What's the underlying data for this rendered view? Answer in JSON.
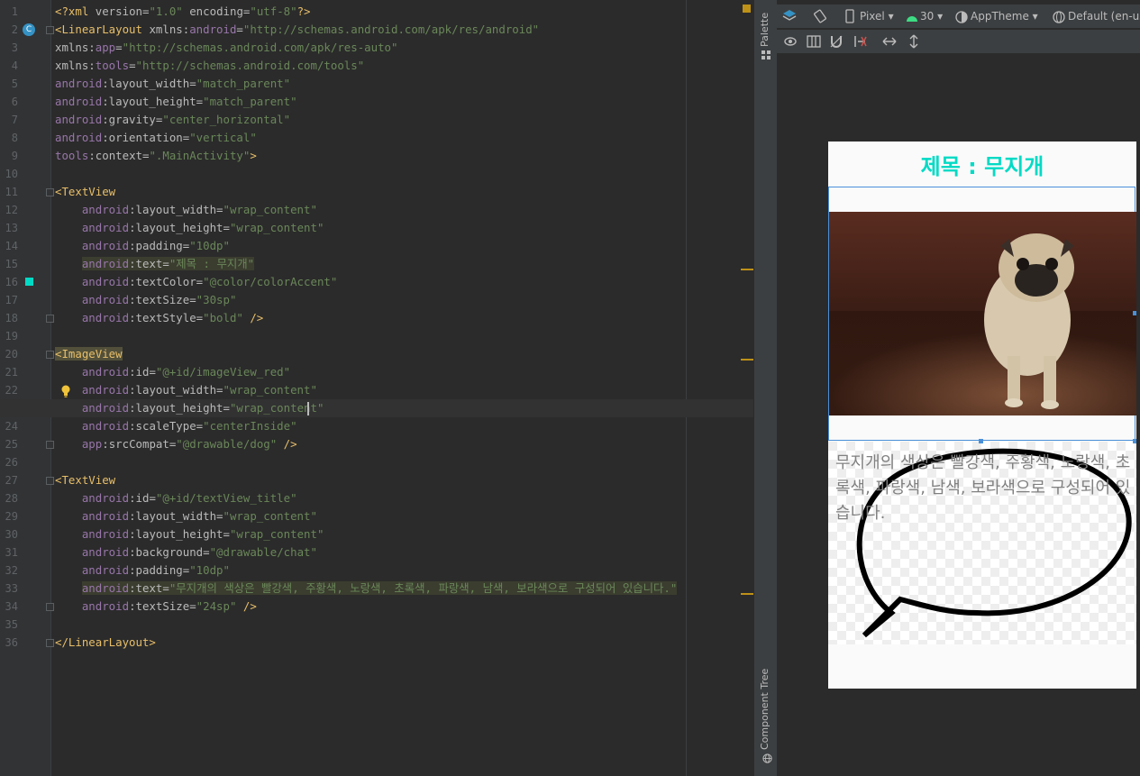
{
  "editor": {
    "lines": [
      {
        "n": "1",
        "tokens": [
          [
            "tag",
            "<?xml "
          ],
          [
            "attr",
            "version="
          ],
          [
            "str",
            "\"1.0\""
          ],
          [
            "attr",
            " encoding="
          ],
          [
            "str",
            "\"utf-8\""
          ],
          [
            "tag",
            "?>"
          ]
        ]
      },
      {
        "n": "2",
        "tokens": [
          [
            "tag",
            "<LinearLayout "
          ],
          [
            "attr",
            "xmlns:"
          ],
          [
            "ns",
            "android"
          ],
          [
            "attr",
            "="
          ],
          [
            "str",
            "\"http://schemas.android.com/apk/res/android\""
          ]
        ]
      },
      {
        "n": "3",
        "tokens": [
          [
            "attr",
            "xmlns:"
          ],
          [
            "ns",
            "app"
          ],
          [
            "attr",
            "="
          ],
          [
            "str",
            "\"http://schemas.android.com/apk/res-auto\""
          ]
        ]
      },
      {
        "n": "4",
        "tokens": [
          [
            "attr",
            "xmlns:"
          ],
          [
            "ns",
            "tools"
          ],
          [
            "attr",
            "="
          ],
          [
            "str",
            "\"http://schemas.android.com/tools\""
          ]
        ]
      },
      {
        "n": "5",
        "tokens": [
          [
            "ns",
            "android"
          ],
          [
            "attr",
            ":layout_width="
          ],
          [
            "str",
            "\"match_parent\""
          ]
        ]
      },
      {
        "n": "6",
        "tokens": [
          [
            "ns",
            "android"
          ],
          [
            "attr",
            ":layout_height="
          ],
          [
            "str",
            "\"match_parent\""
          ]
        ]
      },
      {
        "n": "7",
        "tokens": [
          [
            "ns",
            "android"
          ],
          [
            "attr",
            ":gravity="
          ],
          [
            "str",
            "\"center_horizontal\""
          ]
        ]
      },
      {
        "n": "8",
        "tokens": [
          [
            "ns",
            "android"
          ],
          [
            "attr",
            ":orientation="
          ],
          [
            "str",
            "\"vertical\""
          ]
        ]
      },
      {
        "n": "9",
        "tokens": [
          [
            "ns",
            "tools"
          ],
          [
            "attr",
            ":context="
          ],
          [
            "str",
            "\".MainActivity\""
          ],
          [
            "tag",
            ">"
          ]
        ]
      },
      {
        "n": "10",
        "tokens": []
      },
      {
        "n": "11",
        "tokens": [
          [
            "tag",
            "<TextView"
          ]
        ]
      },
      {
        "n": "12",
        "tokens": [
          [
            "attr",
            "    "
          ],
          [
            "ns",
            "android"
          ],
          [
            "attr",
            ":layout_width="
          ],
          [
            "str",
            "\"wrap_content\""
          ]
        ]
      },
      {
        "n": "13",
        "tokens": [
          [
            "attr",
            "    "
          ],
          [
            "ns",
            "android"
          ],
          [
            "attr",
            ":layout_height="
          ],
          [
            "str",
            "\"wrap_content\""
          ]
        ]
      },
      {
        "n": "14",
        "tokens": [
          [
            "attr",
            "    "
          ],
          [
            "ns",
            "android"
          ],
          [
            "attr",
            ":padding="
          ],
          [
            "str",
            "\"10dp\""
          ]
        ]
      },
      {
        "n": "15",
        "hl": true,
        "tokens": [
          [
            "attr",
            "    "
          ],
          [
            "ns",
            "android"
          ],
          [
            "attr",
            ":text="
          ],
          [
            "str",
            "\"제목 : 무지개\""
          ]
        ]
      },
      {
        "n": "16",
        "tokens": [
          [
            "attr",
            "    "
          ],
          [
            "ns",
            "android"
          ],
          [
            "attr",
            ":textColor="
          ],
          [
            "str",
            "\"@color/colorAccent\""
          ]
        ]
      },
      {
        "n": "17",
        "tokens": [
          [
            "attr",
            "    "
          ],
          [
            "ns",
            "android"
          ],
          [
            "attr",
            ":textSize="
          ],
          [
            "str",
            "\"30sp\""
          ]
        ]
      },
      {
        "n": "18",
        "tokens": [
          [
            "attr",
            "    "
          ],
          [
            "ns",
            "android"
          ],
          [
            "attr",
            ":textStyle="
          ],
          [
            "str",
            "\"bold\""
          ],
          [
            "tag",
            " />"
          ]
        ]
      },
      {
        "n": "19",
        "tokens": []
      },
      {
        "n": "20",
        "tagbox": true,
        "tokens": [
          [
            "tag",
            "<ImageView"
          ]
        ]
      },
      {
        "n": "21",
        "tokens": [
          [
            "attr",
            "    "
          ],
          [
            "ns",
            "android"
          ],
          [
            "attr",
            ":id="
          ],
          [
            "str",
            "\"@+id/imageView_red\""
          ]
        ]
      },
      {
        "n": "22",
        "tokens": [
          [
            "attr",
            "    "
          ],
          [
            "ns",
            "android"
          ],
          [
            "attr",
            ":layout_width="
          ],
          [
            "str",
            "\"wrap_content\""
          ]
        ]
      },
      {
        "n": "23",
        "cur": true,
        "tokens": [
          [
            "attr",
            "    "
          ],
          [
            "ns",
            "android"
          ],
          [
            "attr",
            ":layout_height="
          ],
          [
            "str",
            "\"wrap_content\""
          ]
        ]
      },
      {
        "n": "24",
        "tokens": [
          [
            "attr",
            "    "
          ],
          [
            "ns",
            "android"
          ],
          [
            "attr",
            ":scaleType="
          ],
          [
            "str",
            "\"centerInside\""
          ]
        ]
      },
      {
        "n": "25",
        "tokens": [
          [
            "attr",
            "    "
          ],
          [
            "ns",
            "app"
          ],
          [
            "attr",
            ":srcCompat="
          ],
          [
            "str",
            "\"@drawable/dog\""
          ],
          [
            "tag",
            " />"
          ]
        ]
      },
      {
        "n": "26",
        "tokens": []
      },
      {
        "n": "27",
        "tokens": [
          [
            "tag",
            "<TextView"
          ]
        ]
      },
      {
        "n": "28",
        "tokens": [
          [
            "attr",
            "    "
          ],
          [
            "ns",
            "android"
          ],
          [
            "attr",
            ":id="
          ],
          [
            "str",
            "\"@+id/textView_title\""
          ]
        ]
      },
      {
        "n": "29",
        "tokens": [
          [
            "attr",
            "    "
          ],
          [
            "ns",
            "android"
          ],
          [
            "attr",
            ":layout_width="
          ],
          [
            "str",
            "\"wrap_content\""
          ]
        ]
      },
      {
        "n": "30",
        "tokens": [
          [
            "attr",
            "    "
          ],
          [
            "ns",
            "android"
          ],
          [
            "attr",
            ":layout_height="
          ],
          [
            "str",
            "\"wrap_content\""
          ]
        ]
      },
      {
        "n": "31",
        "tokens": [
          [
            "attr",
            "    "
          ],
          [
            "ns",
            "android"
          ],
          [
            "attr",
            ":background="
          ],
          [
            "str",
            "\"@drawable/chat\""
          ]
        ]
      },
      {
        "n": "32",
        "tokens": [
          [
            "attr",
            "    "
          ],
          [
            "ns",
            "android"
          ],
          [
            "attr",
            ":padding="
          ],
          [
            "str",
            "\"10dp\""
          ]
        ]
      },
      {
        "n": "33",
        "hl": true,
        "tokens": [
          [
            "attr",
            "    "
          ],
          [
            "ns",
            "android"
          ],
          [
            "attr",
            ":text="
          ],
          [
            "str",
            "\"무지개의 색상은 빨강색, 주황색, 노랑색, 초록색, 파랑색, 남색, 보라색으로 구성되어 있습니다.\""
          ]
        ]
      },
      {
        "n": "34",
        "tokens": [
          [
            "attr",
            "    "
          ],
          [
            "ns",
            "android"
          ],
          [
            "attr",
            ":textSize="
          ],
          [
            "str",
            "\"24sp\""
          ],
          [
            "tag",
            " />"
          ]
        ]
      },
      {
        "n": "35",
        "tokens": []
      },
      {
        "n": "36",
        "tokens": [
          [
            "tag",
            "</LinearLayout>"
          ]
        ]
      }
    ],
    "gutter_badge": "C"
  },
  "sidebar": {
    "palette_label": "Palette",
    "component_tree_label": "Component Tree"
  },
  "toolbar": {
    "device": "Pixel",
    "api": "30",
    "theme": "AppTheme",
    "locale": "Default (en-us)"
  },
  "preview": {
    "title": "제목 : 무지개",
    "body": "무지개의 색상은 빨강색, 주황색, 노랑색, 초록색, 파랑색, 남색, 보라색으로 구성되어 있습니다.",
    "accent_color": "#03dac5"
  }
}
